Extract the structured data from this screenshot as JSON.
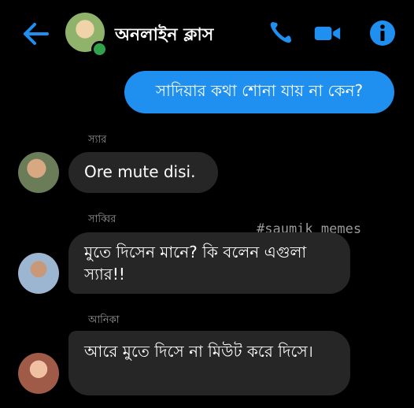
{
  "header": {
    "title": "অনলাইন ক্লাস",
    "back_icon": "arrow-left-icon",
    "call_icon": "phone-icon",
    "video_icon": "video-camera-icon",
    "info_icon": "info-icon",
    "accent_color": "#1f8ff0",
    "online_color": "#31a24c"
  },
  "messages": [
    {
      "type": "outgoing",
      "text": "সাদিয়ার কথা শোনা যায় না কেন?"
    },
    {
      "type": "incoming",
      "sender": "স্যার",
      "text": "Ore mute disi."
    },
    {
      "type": "incoming",
      "sender": "সাব্বির",
      "text": "মুতে দিসেন মানে? কি বলেন এগুলা স্যার!!"
    },
    {
      "type": "incoming",
      "sender": "আনিকা",
      "text": "আরে মুতে দিসে না মিউট করে দিসে।"
    }
  ],
  "watermark": "#saumik_memes"
}
